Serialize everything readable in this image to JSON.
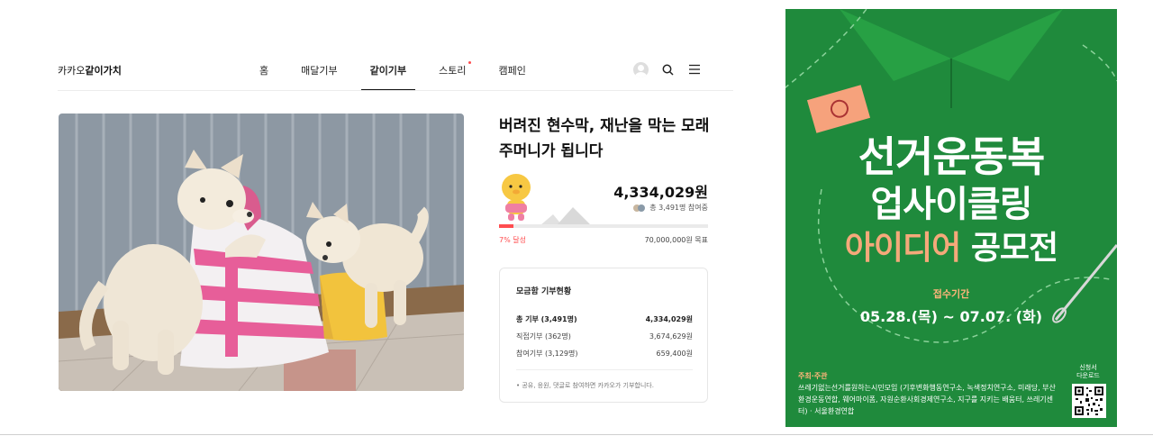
{
  "header": {
    "brand_prefix": "카카오",
    "brand_bold": "같이가치",
    "nav": [
      {
        "label": "홈"
      },
      {
        "label": "매달기부"
      },
      {
        "label": "같이기부"
      },
      {
        "label": "스토리"
      },
      {
        "label": "캠페인"
      }
    ],
    "active_nav": "같이기부",
    "icons": [
      "avatar",
      "search-icon",
      "menu-icon"
    ]
  },
  "campaign": {
    "title_line1": "버려진 현수막, 재난을 막는 모래",
    "title_line2": "주머니가 됩니다",
    "amount": "4,334,029원",
    "participants": "총 3,491명 참여중",
    "progress_label": "7% 달성",
    "progress_value": 0.07,
    "goal": "70,000,000원 목표",
    "accent_color": "#ff4d4f"
  },
  "donation_box": {
    "title": "모금함 기부현황",
    "rows": [
      {
        "label": "총 기부 (3,491명)",
        "value": "4,334,029원"
      },
      {
        "label": "직접기부 (362명)",
        "value": "3,674,629원"
      },
      {
        "label": "참여기부 (3,129명)",
        "value": "659,400원"
      }
    ],
    "note": "• 공유, 응원, 댓글로 참여하면 카카오가 기부합니다."
  },
  "poster": {
    "title_line1": "선거운동복",
    "title_line2": "업사이클링",
    "title_line3a": "아이디어",
    "title_line3b": " 공모전",
    "period_label": "접수기간",
    "dates": "05.28.(목) ~ 07.07. (화)",
    "org_label": "주최·주관",
    "org_text": "쓰레기없는선거를원하는시민모임 (기후변화행동연구소, 녹색정치연구소, 미래당, 부산환경운동연합, 웨어마이폼, 자원순환사회경제연구소, 지구를 지키는 배움터, 쓰레기센터) · 서울환경연합",
    "apply_label_1": "신청서",
    "apply_label_2": "다운로드",
    "bg_color": "#1f8a3c"
  }
}
